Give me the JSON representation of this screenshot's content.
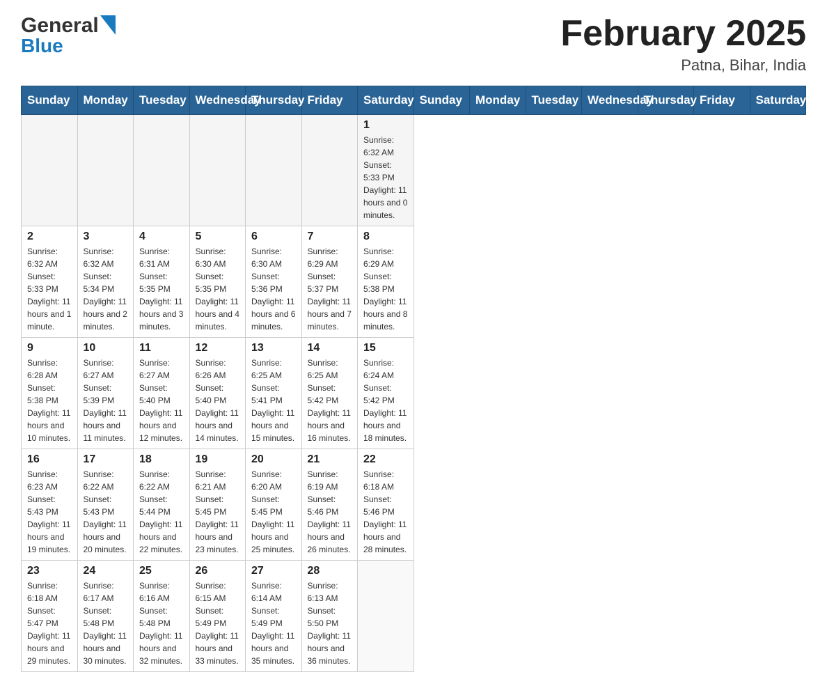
{
  "header": {
    "logo_general": "General",
    "logo_blue": "Blue",
    "title": "February 2025",
    "location": "Patna, Bihar, India"
  },
  "days_of_week": [
    "Sunday",
    "Monday",
    "Tuesday",
    "Wednesday",
    "Thursday",
    "Friday",
    "Saturday"
  ],
  "weeks": [
    {
      "days": [
        {
          "date": "",
          "info": ""
        },
        {
          "date": "",
          "info": ""
        },
        {
          "date": "",
          "info": ""
        },
        {
          "date": "",
          "info": ""
        },
        {
          "date": "",
          "info": ""
        },
        {
          "date": "",
          "info": ""
        },
        {
          "date": "1",
          "info": "Sunrise: 6:32 AM\nSunset: 5:33 PM\nDaylight: 11 hours and 0 minutes."
        }
      ]
    },
    {
      "days": [
        {
          "date": "2",
          "info": "Sunrise: 6:32 AM\nSunset: 5:33 PM\nDaylight: 11 hours and 1 minute."
        },
        {
          "date": "3",
          "info": "Sunrise: 6:32 AM\nSunset: 5:34 PM\nDaylight: 11 hours and 2 minutes."
        },
        {
          "date": "4",
          "info": "Sunrise: 6:31 AM\nSunset: 5:35 PM\nDaylight: 11 hours and 3 minutes."
        },
        {
          "date": "5",
          "info": "Sunrise: 6:30 AM\nSunset: 5:35 PM\nDaylight: 11 hours and 4 minutes."
        },
        {
          "date": "6",
          "info": "Sunrise: 6:30 AM\nSunset: 5:36 PM\nDaylight: 11 hours and 6 minutes."
        },
        {
          "date": "7",
          "info": "Sunrise: 6:29 AM\nSunset: 5:37 PM\nDaylight: 11 hours and 7 minutes."
        },
        {
          "date": "8",
          "info": "Sunrise: 6:29 AM\nSunset: 5:38 PM\nDaylight: 11 hours and 8 minutes."
        }
      ]
    },
    {
      "days": [
        {
          "date": "9",
          "info": "Sunrise: 6:28 AM\nSunset: 5:38 PM\nDaylight: 11 hours and 10 minutes."
        },
        {
          "date": "10",
          "info": "Sunrise: 6:27 AM\nSunset: 5:39 PM\nDaylight: 11 hours and 11 minutes."
        },
        {
          "date": "11",
          "info": "Sunrise: 6:27 AM\nSunset: 5:40 PM\nDaylight: 11 hours and 12 minutes."
        },
        {
          "date": "12",
          "info": "Sunrise: 6:26 AM\nSunset: 5:40 PM\nDaylight: 11 hours and 14 minutes."
        },
        {
          "date": "13",
          "info": "Sunrise: 6:25 AM\nSunset: 5:41 PM\nDaylight: 11 hours and 15 minutes."
        },
        {
          "date": "14",
          "info": "Sunrise: 6:25 AM\nSunset: 5:42 PM\nDaylight: 11 hours and 16 minutes."
        },
        {
          "date": "15",
          "info": "Sunrise: 6:24 AM\nSunset: 5:42 PM\nDaylight: 11 hours and 18 minutes."
        }
      ]
    },
    {
      "days": [
        {
          "date": "16",
          "info": "Sunrise: 6:23 AM\nSunset: 5:43 PM\nDaylight: 11 hours and 19 minutes."
        },
        {
          "date": "17",
          "info": "Sunrise: 6:22 AM\nSunset: 5:43 PM\nDaylight: 11 hours and 20 minutes."
        },
        {
          "date": "18",
          "info": "Sunrise: 6:22 AM\nSunset: 5:44 PM\nDaylight: 11 hours and 22 minutes."
        },
        {
          "date": "19",
          "info": "Sunrise: 6:21 AM\nSunset: 5:45 PM\nDaylight: 11 hours and 23 minutes."
        },
        {
          "date": "20",
          "info": "Sunrise: 6:20 AM\nSunset: 5:45 PM\nDaylight: 11 hours and 25 minutes."
        },
        {
          "date": "21",
          "info": "Sunrise: 6:19 AM\nSunset: 5:46 PM\nDaylight: 11 hours and 26 minutes."
        },
        {
          "date": "22",
          "info": "Sunrise: 6:18 AM\nSunset: 5:46 PM\nDaylight: 11 hours and 28 minutes."
        }
      ]
    },
    {
      "days": [
        {
          "date": "23",
          "info": "Sunrise: 6:18 AM\nSunset: 5:47 PM\nDaylight: 11 hours and 29 minutes."
        },
        {
          "date": "24",
          "info": "Sunrise: 6:17 AM\nSunset: 5:48 PM\nDaylight: 11 hours and 30 minutes."
        },
        {
          "date": "25",
          "info": "Sunrise: 6:16 AM\nSunset: 5:48 PM\nDaylight: 11 hours and 32 minutes."
        },
        {
          "date": "26",
          "info": "Sunrise: 6:15 AM\nSunset: 5:49 PM\nDaylight: 11 hours and 33 minutes."
        },
        {
          "date": "27",
          "info": "Sunrise: 6:14 AM\nSunset: 5:49 PM\nDaylight: 11 hours and 35 minutes."
        },
        {
          "date": "28",
          "info": "Sunrise: 6:13 AM\nSunset: 5:50 PM\nDaylight: 11 hours and 36 minutes."
        },
        {
          "date": "",
          "info": ""
        }
      ]
    }
  ]
}
